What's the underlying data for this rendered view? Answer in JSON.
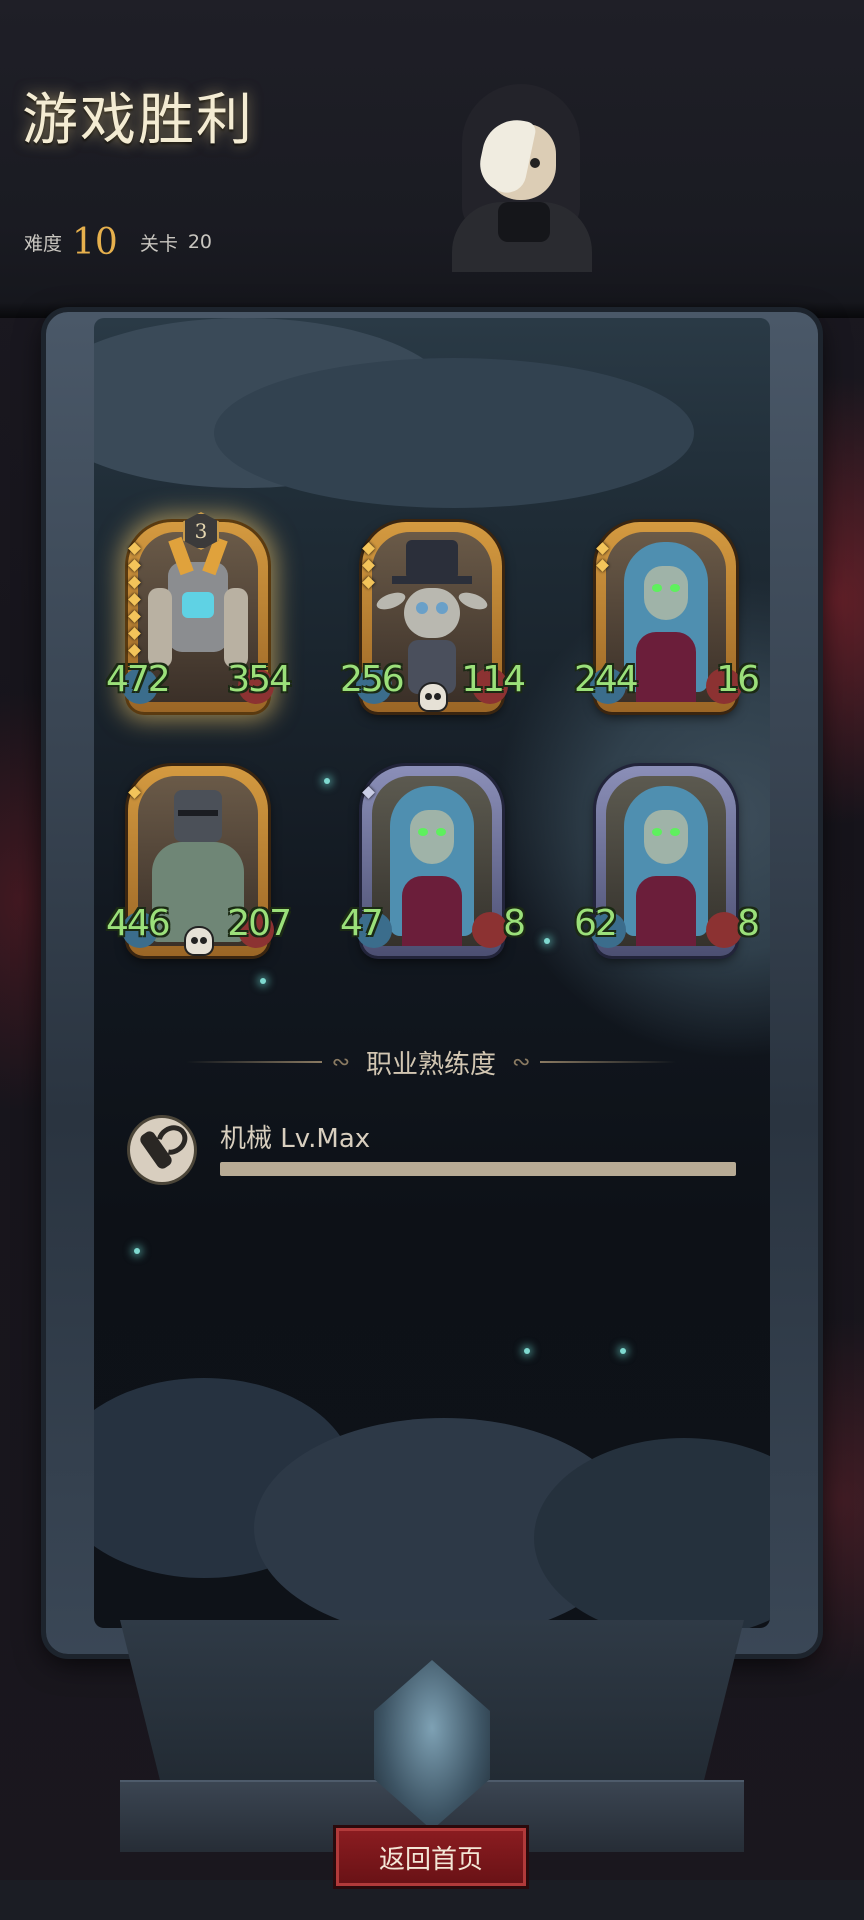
{
  "header": {
    "title": "游戏胜利",
    "difficulty_label": "难度",
    "difficulty_value": "10",
    "stage_label": "关卡",
    "stage_value": "20"
  },
  "team": [
    {
      "level": "3",
      "attack": "472",
      "health": "354",
      "frame": "gold",
      "selected": true,
      "skull": false,
      "unit": "mech-robot"
    },
    {
      "attack": "256",
      "health": "114",
      "frame": "gold",
      "skull": true,
      "unit": "top-hat-goblin"
    },
    {
      "attack": "244",
      "health": "16",
      "frame": "gold",
      "skull": false,
      "unit": "blue-haired-elf"
    },
    {
      "attack": "446",
      "health": "207",
      "frame": "gold",
      "skull": true,
      "unit": "armored-knight"
    },
    {
      "attack": "47",
      "health": "8",
      "frame": "silver",
      "skull": false,
      "unit": "blue-haired-elf"
    },
    {
      "attack": "62",
      "health": "8",
      "frame": "silver",
      "skull": false,
      "unit": "blue-haired-elf"
    }
  ],
  "proficiency": {
    "section_title": "职业熟练度",
    "class_label": "机械 Lv.Max",
    "progress": 1.0,
    "icon": "wrench-icon"
  },
  "footer": {
    "home_button": "返回首页"
  }
}
